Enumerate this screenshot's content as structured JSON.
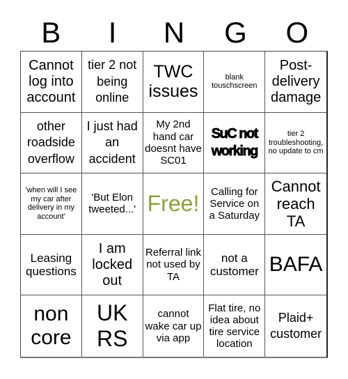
{
  "header": {
    "letters": [
      "B",
      "I",
      "N",
      "G",
      "O"
    ]
  },
  "free_color": "#8aa13b",
  "cells": [
    {
      "text": "Cannot log into account",
      "free": false
    },
    {
      "text": "tier 2 not being online",
      "free": false
    },
    {
      "text": "TWC issues",
      "free": false
    },
    {
      "text": "blank touschscreen",
      "free": false
    },
    {
      "text": "Post-delivery damage",
      "free": false
    },
    {
      "text": "other roadside overflow",
      "free": false
    },
    {
      "text": "I just had an accident",
      "free": false
    },
    {
      "text": "My 2nd hand car doesnt have SC01",
      "free": false
    },
    {
      "text": "SuC not working",
      "free": false
    },
    {
      "text": "tier 2 troubleshooting, no update to cm",
      "free": false
    },
    {
      "text": "'when will I see my car after delivery in my account'",
      "free": false
    },
    {
      "text": "'But Elon tweeted...'",
      "free": false
    },
    {
      "text": "Free!",
      "free": true
    },
    {
      "text": "Calling for Service on a Saturday",
      "free": false
    },
    {
      "text": "Cannot reach TA",
      "free": false
    },
    {
      "text": "Leasing questions",
      "free": false
    },
    {
      "text": "I am locked out",
      "free": false
    },
    {
      "text": "Referral link not used by TA",
      "free": false
    },
    {
      "text": "not a customer",
      "free": false
    },
    {
      "text": "BAFA",
      "free": false
    },
    {
      "text": "non core",
      "free": false
    },
    {
      "text": "UK RS",
      "free": false
    },
    {
      "text": "cannot wake car up via app",
      "free": false
    },
    {
      "text": "Flat tire, no idea about tire service location",
      "free": false
    },
    {
      "text": "Plaid+ customer",
      "free": false
    }
  ]
}
